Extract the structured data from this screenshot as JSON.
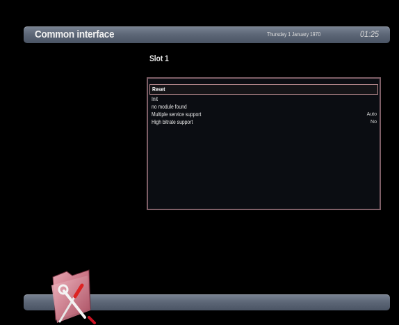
{
  "header": {
    "title": "Common interface",
    "date": "Thursday 1 January 1970",
    "time": "01:25"
  },
  "slot": {
    "title": "Slot 1"
  },
  "menu": {
    "items": [
      {
        "label": "Reset",
        "value": "",
        "selected": true
      },
      {
        "label": "Init",
        "value": "",
        "selected": false
      },
      {
        "label": "no module found",
        "value": "",
        "selected": false
      },
      {
        "label": "Multiple service support",
        "value": "Auto",
        "selected": false
      },
      {
        "label": "High bitrate support",
        "value": "No",
        "selected": false
      }
    ]
  },
  "footer": {
    "icon": "tools-icon"
  },
  "colors": {
    "bar_top": "#7a8494",
    "bar_bottom": "#4a5464",
    "panel_border": "#7e5e66",
    "selection_border": "#b98b8f",
    "background": "#000000"
  }
}
